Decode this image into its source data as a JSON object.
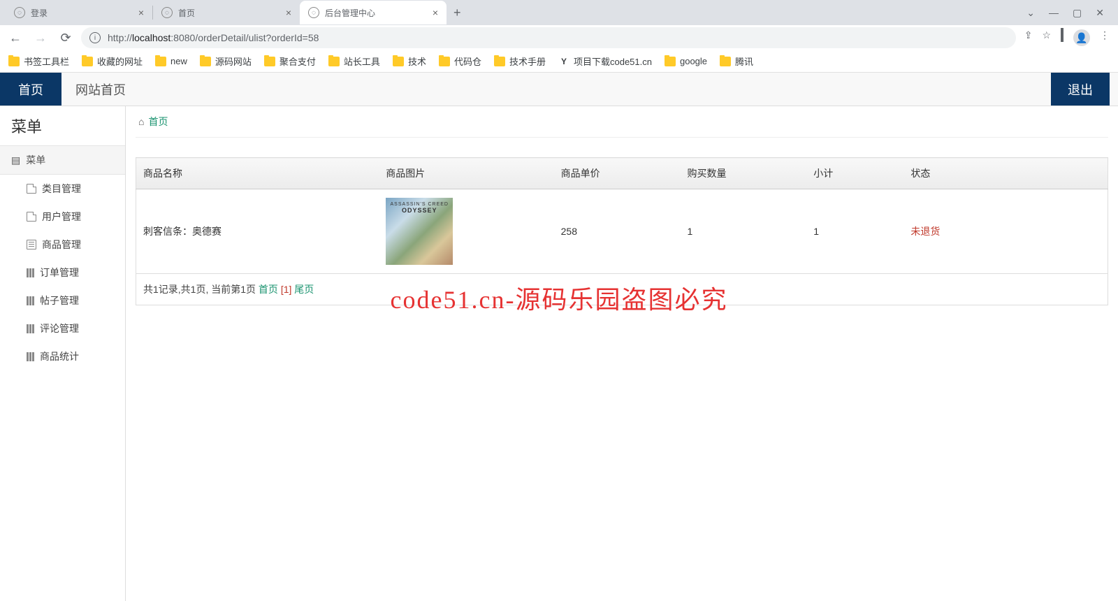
{
  "browser": {
    "tabs": [
      {
        "title": "登录",
        "active": false
      },
      {
        "title": "首页",
        "active": false
      },
      {
        "title": "后台管理中心",
        "active": true
      }
    ],
    "url_host": "localhost",
    "url_port": ":8080",
    "url_prefix": "http://",
    "url_path": "/orderDetail/ulist?orderId=58",
    "bookmarks": [
      {
        "label": "书签工具栏",
        "type": "folder"
      },
      {
        "label": "收藏的网址",
        "type": "folder"
      },
      {
        "label": "new",
        "type": "folder"
      },
      {
        "label": "源码网站",
        "type": "folder"
      },
      {
        "label": "聚合支付",
        "type": "folder"
      },
      {
        "label": "站长工具",
        "type": "folder"
      },
      {
        "label": "技术",
        "type": "folder"
      },
      {
        "label": "代码仓",
        "type": "folder"
      },
      {
        "label": "技术手册",
        "type": "folder"
      },
      {
        "label": "项目下载code51.cn",
        "type": "custom"
      },
      {
        "label": "google",
        "type": "folder"
      },
      {
        "label": "腾讯",
        "type": "folder"
      }
    ]
  },
  "header": {
    "home": "首页",
    "site_home": "网站首页",
    "logout": "退出"
  },
  "sidebar": {
    "title": "菜单",
    "root": "菜单",
    "items": [
      {
        "label": "类目管理",
        "icon": "page"
      },
      {
        "label": "用户管理",
        "icon": "page"
      },
      {
        "label": "商品管理",
        "icon": "list"
      },
      {
        "label": "订单管理",
        "icon": "books"
      },
      {
        "label": "帖子管理",
        "icon": "books"
      },
      {
        "label": "评论管理",
        "icon": "books"
      },
      {
        "label": "商品统计",
        "icon": "books"
      }
    ]
  },
  "breadcrumb": {
    "home": "首页"
  },
  "table": {
    "headers": {
      "name": "商品名称",
      "image": "商品图片",
      "price": "商品单价",
      "qty": "购买数量",
      "subtotal": "小计",
      "status": "状态"
    },
    "row": {
      "name": "刺客信条：奥德赛",
      "image_caption_1": "ASSASSIN'S CREED",
      "image_caption_2": "ODYSSEY",
      "price": "258",
      "qty": "1",
      "subtotal": "1",
      "status": "未退货"
    },
    "pager": {
      "summary": "共1记录,共1页, 当前第1页 ",
      "first": "首页",
      "current": "[1]",
      "last": "尾页"
    }
  },
  "watermark": "code51.cn-源码乐园盗图必究"
}
